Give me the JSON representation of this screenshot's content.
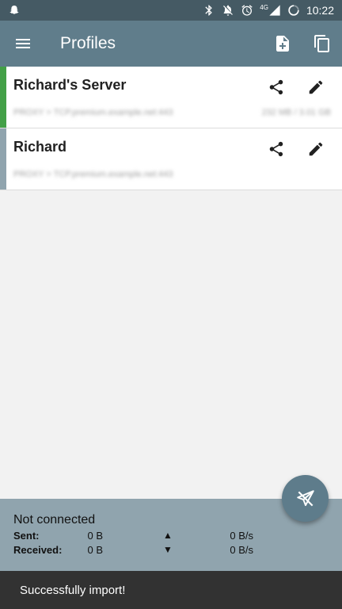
{
  "status_bar": {
    "network_label": "4G",
    "time": "10:22"
  },
  "app_bar": {
    "title": "Profiles"
  },
  "profiles": [
    {
      "name": "Richard's Server",
      "server": "PROXY > TCP.premium.example.net:443",
      "traffic": "232 MB / 3.01 GB",
      "accent_color": "#43a047"
    },
    {
      "name": "Richard",
      "server": "PROXY > TCP.premium.example.net:443",
      "traffic": "",
      "accent_color": "#90a4ae"
    }
  ],
  "connection": {
    "status": "Not connected",
    "sent_label": "Sent:",
    "sent_total": "0 B",
    "sent_rate": "0 B/s",
    "received_label": "Received:",
    "received_total": "0 B",
    "received_rate": "0 B/s"
  },
  "snackbar": {
    "message": "Successfully import!"
  },
  "colors": {
    "status_bar": "#455a64",
    "app_bar": "#607d8b",
    "bottom_panel": "#90a4ae",
    "fab": "#5e7c8b"
  }
}
